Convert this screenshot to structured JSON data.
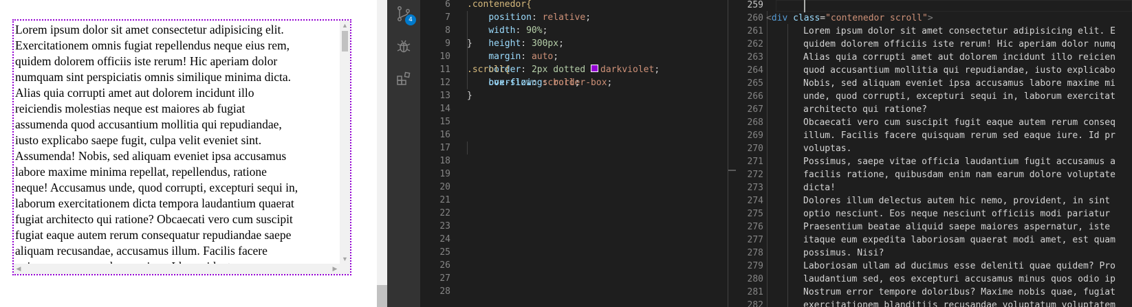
{
  "preview": {
    "lines": [
      "Lorem ipsum dolor sit amet consectetur adipisicing elit.",
      "Exercitationem omnis fugiat repellendus neque eius rem,",
      "quidem dolorem officiis iste rerum! Hic aperiam dolor",
      "numquam sint perspiciatis omnis similique minima dicta.",
      "Alias quia corrupti amet aut dolorem incidunt illo",
      "reiciendis molestias neque est maiores ab fugiat",
      "assumenda quod accusantium mollitia qui repudiandae,",
      "iusto explicabo saepe fugit, culpa velit eveniet sint.",
      "Assumenda! Nobis, sed aliquam eveniet ipsa accusamus",
      "labore maxime minima repellat, repellendus, ratione",
      "neque! Accusamus unde, quod corrupti, excepturi sequi in,",
      "laborum exercitationem dicta tempora laudantium quaerat",
      "fugiat architecto qui ratione? Obcaecati vero cum suscipit",
      "fugiat eaque autem rerum consequatur repudiandae saepe",
      "aliquam recusandae, accusamus illum. Facilis facere",
      "quisquam rerum sed eaque iure. Id provident"
    ],
    "border_color": "#9400d3"
  },
  "activity": {
    "icons": [
      "source-control-icon",
      "debug-icon",
      "extensions-icon"
    ],
    "badge": "4",
    "accent": "#007acc"
  },
  "css_editor": {
    "line_numbers": [
      "6",
      "7",
      "8",
      "9",
      "10",
      "11",
      "12",
      "13",
      "14",
      "15",
      "16",
      "17",
      "18",
      "19",
      "20",
      "21",
      "22",
      "23",
      "24",
      "25",
      "26",
      "27",
      "28"
    ],
    "selector1": ".contenedor{",
    "props": [
      {
        "name": "position",
        "value": "relative"
      },
      {
        "name": "width",
        "value": "90%"
      },
      {
        "name": "height",
        "value": "300px"
      },
      {
        "name": "margin",
        "value": "auto"
      },
      {
        "name": "border",
        "value": "2px dotted ",
        "color_name": "darkviolet"
      },
      {
        "name": "box-sizing",
        "value": "border-box"
      }
    ],
    "close1": "}",
    "selector2": ".scroll{",
    "prop2": {
      "name": "overflow",
      "value": "scroll"
    },
    "close2": "}"
  },
  "html_editor": {
    "line_numbers": [
      "259",
      "260",
      "261",
      "262",
      "263",
      "264",
      "265",
      "266",
      "267",
      "268",
      "269",
      "270",
      "271",
      "272",
      "273",
      "274",
      "275",
      "276",
      "277",
      "278",
      "279",
      "280",
      "281",
      "282"
    ],
    "div_open": {
      "tag": "div",
      "attr": "class",
      "value": "\"contenedor scroll\""
    },
    "lines": [
      "Lorem ipsum dolor sit amet consectetur adipisicing elit. E",
      "quidem dolorem officiis iste rerum! Hic aperiam dolor numq",
      "Alias quia corrupti amet aut dolorem incidunt illo reicien",
      "quod accusantium mollitia qui repudiandae, iusto explicabo",
      "Nobis, sed aliquam eveniet ipsa accusamus labore maxime mi",
      "unde, quod corrupti, excepturi sequi in, laborum exercitat",
      "architecto qui ratione?",
      "Obcaecati vero cum suscipit fugit eaque autem rerum conseq",
      "illum. Facilis facere quisquam rerum sed eaque iure. Id pr",
      "voluptas.",
      "Possimus, saepe vitae officia laudantium fugit accusamus a",
      "facilis ratione, quibusdam enim nam earum dolore voluptate",
      "dicta!",
      "Dolores illum delectus autem hic nemo, provident, in sint",
      "optio nesciunt. Eos neque nesciunt officiis modi pariatur",
      "Praesentium beatae aliquid saepe maiores aspernatur, iste",
      "itaque eum expedita laboriosam quaerat modi amet, est quam",
      "possimus. Nisi?",
      "Laboriosam ullam ad ducimus esse deleniti quae quidem? Pro",
      "laudantium sed, eos excepturi accusamus minus quos odio ip",
      "Nostrum error tempore doloribus? Maxime nobis quae, fugiat",
      "exercitationem blanditiis recusandae voluptatum voluptatem"
    ]
  }
}
